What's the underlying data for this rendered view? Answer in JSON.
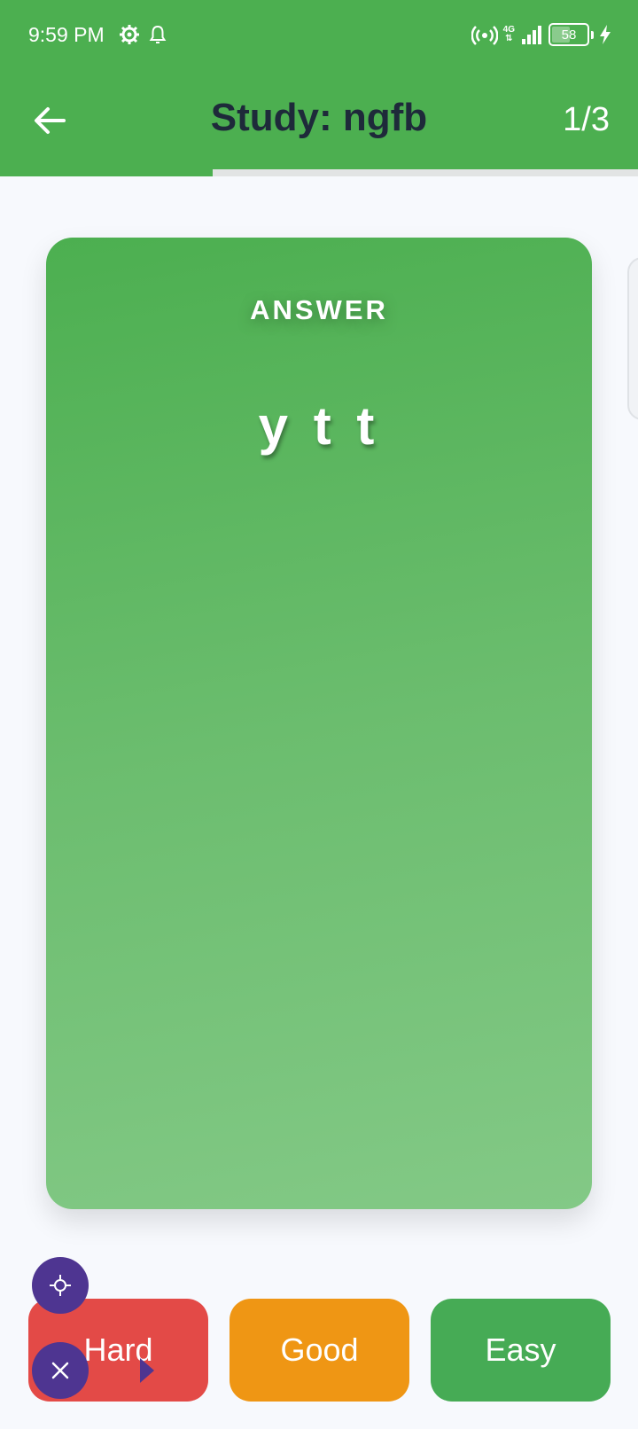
{
  "status_bar": {
    "time": "9:59 PM",
    "network": "4G",
    "battery": "58",
    "battery_level": 0.58
  },
  "header": {
    "title": "Study: ngfb",
    "counter": "1/3",
    "progress": 0.333
  },
  "card": {
    "label": "ANSWER",
    "text": "y t t"
  },
  "actions": {
    "hard_label": "Hard",
    "good_label": "Good",
    "easy_label": "Easy"
  },
  "colors": {
    "primary": "#4caf50",
    "title_text": "#1e2a3a",
    "hard": "#e34a47",
    "good": "#ef9614",
    "easy": "#46ab55",
    "fab": "#4e3591"
  },
  "icons": [
    "gear-icon",
    "bell-icon",
    "hotspot-icon",
    "signal-icon",
    "battery-icon",
    "charging-bolt-icon",
    "arrow-left-icon",
    "crosshair-icon",
    "close-icon",
    "play-arrow-icon"
  ]
}
